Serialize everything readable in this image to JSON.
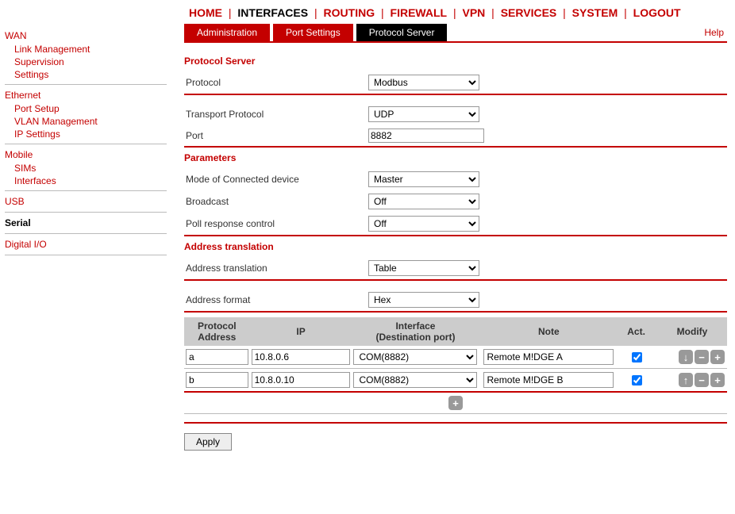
{
  "topnav": {
    "items": [
      "HOME",
      "INTERFACES",
      "ROUTING",
      "FIREWALL",
      "VPN",
      "SERVICES",
      "SYSTEM",
      "LOGOUT"
    ],
    "active_index": 1
  },
  "help_label": "Help",
  "sidebar": [
    {
      "head": "WAN",
      "selected": false,
      "subs": [
        "Link Management",
        "Supervision",
        "Settings"
      ]
    },
    {
      "head": "Ethernet",
      "selected": false,
      "subs": [
        "Port Setup",
        "VLAN Management",
        "IP Settings"
      ]
    },
    {
      "head": "Mobile",
      "selected": false,
      "subs": [
        "SIMs",
        "Interfaces"
      ]
    },
    {
      "head": "USB",
      "selected": false,
      "subs": []
    },
    {
      "head": "Serial",
      "selected": true,
      "subs": []
    },
    {
      "head": "Digital I/O",
      "selected": false,
      "subs": []
    }
  ],
  "tabs": [
    {
      "label": "Administration",
      "style": "red"
    },
    {
      "label": "Port Settings",
      "style": "red"
    },
    {
      "label": "Protocol Server",
      "style": "dark"
    }
  ],
  "sections": {
    "protocol_server_title": "Protocol Server",
    "protocol_label": "Protocol",
    "protocol_value": "Modbus",
    "transport_label": "Transport Protocol",
    "transport_value": "UDP",
    "port_label": "Port",
    "port_value": "8882",
    "params_title": "Parameters",
    "mode_label": "Mode of Connected device",
    "mode_value": "Master",
    "broadcast_label": "Broadcast",
    "broadcast_value": "Off",
    "poll_label": "Poll response control",
    "poll_value": "Off",
    "addr_title": "Address translation",
    "addr_translation_label": "Address translation",
    "addr_translation_value": "Table",
    "addr_format_label": "Address format",
    "addr_format_value": "Hex"
  },
  "table": {
    "headers": {
      "proto": "Protocol",
      "proto_sub": "Address",
      "ip": "IP",
      "iface": "Interface",
      "iface_sub": "(Destination port)",
      "note": "Note",
      "act": "Act.",
      "mod": "Modify"
    },
    "rows": [
      {
        "proto": "a",
        "ip": "10.8.0.6",
        "iface": "COM(8882)",
        "note": "Remote M!DGE A",
        "act": true,
        "show_up": false,
        "show_down": true
      },
      {
        "proto": "b",
        "ip": "10.8.0.10",
        "iface": "COM(8882)",
        "note": "Remote M!DGE B",
        "act": true,
        "show_up": true,
        "show_down": false
      }
    ]
  },
  "apply_label": "Apply"
}
